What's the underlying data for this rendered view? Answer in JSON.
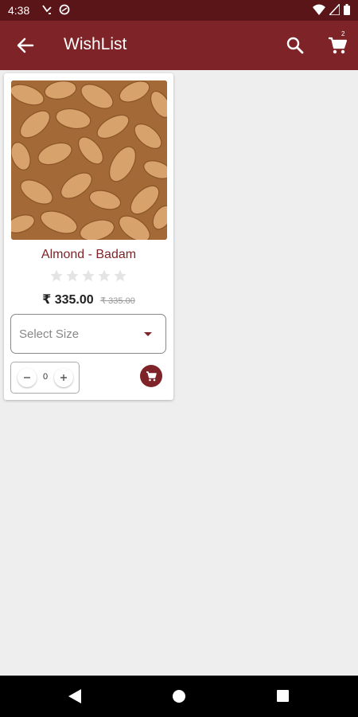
{
  "status_bar": {
    "time": "4:38",
    "left_icons": [
      "missed-call-icon",
      "data-saver-icon"
    ],
    "right_icons": [
      "wifi-icon",
      "signal-icon",
      "battery-icon"
    ]
  },
  "app_bar": {
    "title": "WishList",
    "back_icon": "arrow-back-icon",
    "search_icon": "search-icon",
    "cart_icon": "cart-icon",
    "cart_count": "2",
    "color": "#7e2428"
  },
  "products": [
    {
      "name": "Almond - Badam",
      "rating": 0,
      "rating_max": 5,
      "price": "₹ 335.00",
      "old_price": "₹ 335.00",
      "size_placeholder": "Select Size",
      "quantity": "0",
      "add_to_cart_icon": "cart-icon"
    }
  ],
  "nav_bar": {
    "icons": [
      "back-triangle-icon",
      "home-circle-icon",
      "recents-square-icon"
    ]
  }
}
